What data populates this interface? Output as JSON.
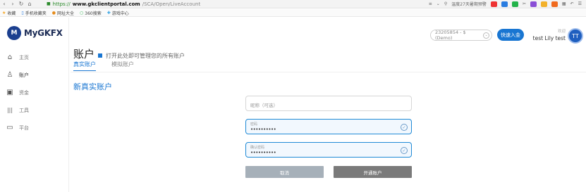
{
  "browser": {
    "url_scheme": "https://",
    "url_host": "www.gkclientportal.com",
    "url_path": "/SCA/Open/LiveAccount",
    "notice": "温度27天暑期预警"
  },
  "bookmarks": [
    {
      "label": "收藏",
      "icon": "star-icon"
    },
    {
      "label": "手机收藏夹",
      "icon": "phone-icon"
    },
    {
      "label": "网址大全",
      "icon": "globe-icon"
    },
    {
      "label": "360搜索",
      "icon": "search-icon"
    },
    {
      "label": "游戏中心",
      "icon": "game-icon"
    }
  ],
  "logo": {
    "badge": "M",
    "text": "MyGKFX"
  },
  "sidebar": {
    "items": [
      {
        "label": "主页",
        "icon": "home-icon",
        "glyph": "⌂"
      },
      {
        "label": "账户",
        "icon": "user-icon",
        "glyph": "♙"
      },
      {
        "label": "资金",
        "icon": "wallet-icon",
        "glyph": "▣"
      },
      {
        "label": "工具",
        "icon": "tools-icon",
        "glyph": "|||"
      },
      {
        "label": "平台",
        "icon": "platform-icon",
        "glyph": "▭"
      }
    ]
  },
  "header": {
    "account_select": "23205854 - $ (Demo)",
    "deposit_label": "快速入金",
    "welcome_hint": "欢迎",
    "user_name": "test Lily test",
    "avatar_initials": "TT"
  },
  "page": {
    "title": "账户",
    "hint": "打开此处即可管理您的所有账户",
    "tabs": [
      {
        "label": "真实账户",
        "active": true
      },
      {
        "label": "模拟账户",
        "active": false
      }
    ],
    "section_title": "新真实账户"
  },
  "form": {
    "nickname_placeholder": "昵称（可选）",
    "password_label": "密码",
    "password_value": "••••••••••",
    "confirm_label": "确认密码",
    "confirm_value": "••••••••••",
    "cancel_label": "取消",
    "open_label": "开通账户"
  },
  "colors": {
    "accent": "#1976d2",
    "logo": "#1b3f8f"
  }
}
